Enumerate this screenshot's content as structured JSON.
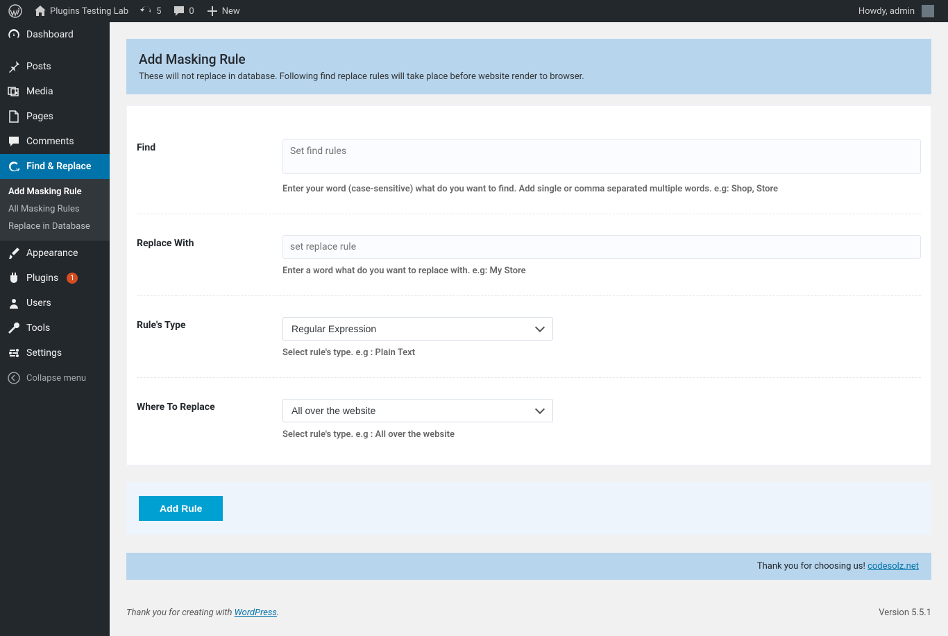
{
  "topbar": {
    "site_name": "Plugins Testing Lab",
    "updates": "5",
    "comments": "0",
    "new": "New",
    "greeting": "Howdy, admin"
  },
  "sidebar": {
    "dashboard": "Dashboard",
    "posts": "Posts",
    "media": "Media",
    "pages": "Pages",
    "comments": "Comments",
    "find_replace": "Find & Replace",
    "sub_add": "Add Masking Rule",
    "sub_all": "All Masking Rules",
    "sub_db": "Replace in Database",
    "appearance": "Appearance",
    "plugins": "Plugins",
    "plugins_badge": "1",
    "users": "Users",
    "tools": "Tools",
    "settings": "Settings",
    "collapse": "Collapse menu"
  },
  "header": {
    "title": "Add Masking Rule",
    "desc": "These will not replace in database. Following find replace rules will take place before website render to browser."
  },
  "form": {
    "find_label": "Find",
    "find_placeholder": "Set find rules",
    "find_hint": "Enter your word (case-sensitive) what do you want to find. Add single or comma separated multiple words. e.g: Shop, Store",
    "replace_label": "Replace With",
    "replace_placeholder": "set replace rule",
    "replace_hint": "Enter a word what do you want to replace with. e.g: My Store",
    "type_label": "Rule's Type",
    "type_value": "Regular Expression",
    "type_hint": "Select rule's type. e.g : Plain Text",
    "where_label": "Where To Replace",
    "where_value": "All over the website",
    "where_hint": "Select rule's type. e.g : All over the website",
    "button": "Add Rule"
  },
  "thanks": {
    "text": "Thank you for choosing us! ",
    "link": "codesolz.net"
  },
  "footer": {
    "text": "Thank you for creating with ",
    "link": "WordPress",
    "version": "Version 5.5.1"
  }
}
